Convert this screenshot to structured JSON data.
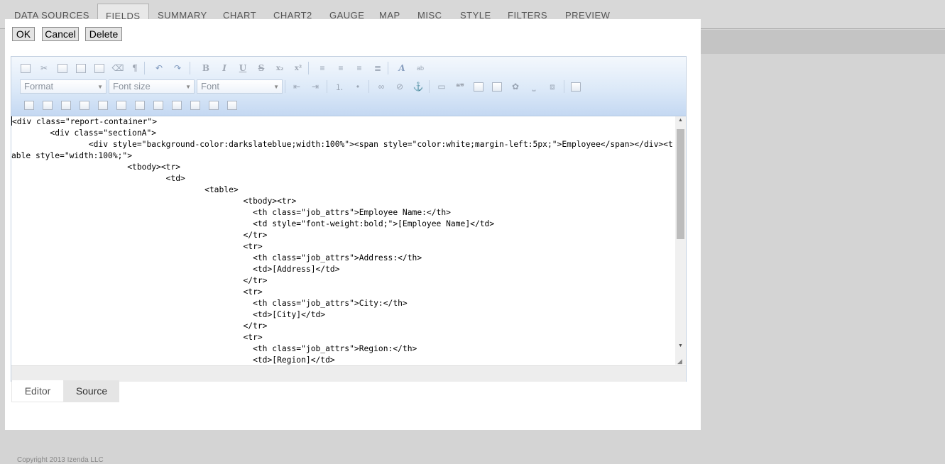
{
  "tabs": [
    {
      "label": "DATA SOURCES"
    },
    {
      "label": "FIELDS"
    },
    {
      "label": "SUMMARY"
    },
    {
      "label": "CHART"
    },
    {
      "label": "CHART2"
    },
    {
      "label": "GAUGE"
    },
    {
      "label": "MAP"
    },
    {
      "label": "MISC"
    },
    {
      "label": "STYLE"
    },
    {
      "label": "FILTERS"
    },
    {
      "label": "PREVIEW"
    }
  ],
  "dialog": {
    "ok_label": "OK",
    "cancel_label": "Cancel",
    "delete_label": "Delete"
  },
  "toolbar": {
    "format_placeholder": "Format",
    "fontsize_placeholder": "Font size",
    "font_placeholder": "Font",
    "bold": "B",
    "italic": "I",
    "underline": "U",
    "strike": "S",
    "subscript": "x₂",
    "superscript": "x²",
    "pilcrow": "¶",
    "quote": "❝❞"
  },
  "source_lines": [
    "<div class=\"report-container\">",
    "        <div class=\"sectionA\">",
    "                <div style=\"background-color:darkslateblue;width:100%\"><span style=\"color:white;margin-left:5px;\">Employee</span></div><table style=\"width:100%;\">",
    "                        <tbody><tr>",
    "                                <td>",
    "                                        <table>",
    "                                                <tbody><tr>",
    "                                                  <th class=\"job_attrs\">Employee Name:</th>",
    "                                                  <td style=\"font-weight:bold;\">[Employee Name]</td>",
    "                                                </tr>",
    "                                                <tr>",
    "                                                  <th class=\"job_attrs\">Address:</th>",
    "                                                  <td>[Address]</td>",
    "                                                </tr>",
    "                                                <tr>",
    "                                                  <th class=\"job_attrs\">City:</th>",
    "                                                  <td>[City]</td>",
    "                                                </tr>",
    "                                                <tr>",
    "                                                  <th class=\"job_attrs\">Region:</th>",
    "                                                  <td>[Region]</td>"
  ],
  "mode_tabs": {
    "editor": "Editor",
    "source": "Source",
    "active": "Source"
  },
  "footer": {
    "text": "Copyright 2013 Izenda LLC"
  },
  "colors": {
    "toolbar_top": "#f4f8fd",
    "toolbar_bottom": "#c4d8f2",
    "page_bg": "#d4d4d4"
  }
}
